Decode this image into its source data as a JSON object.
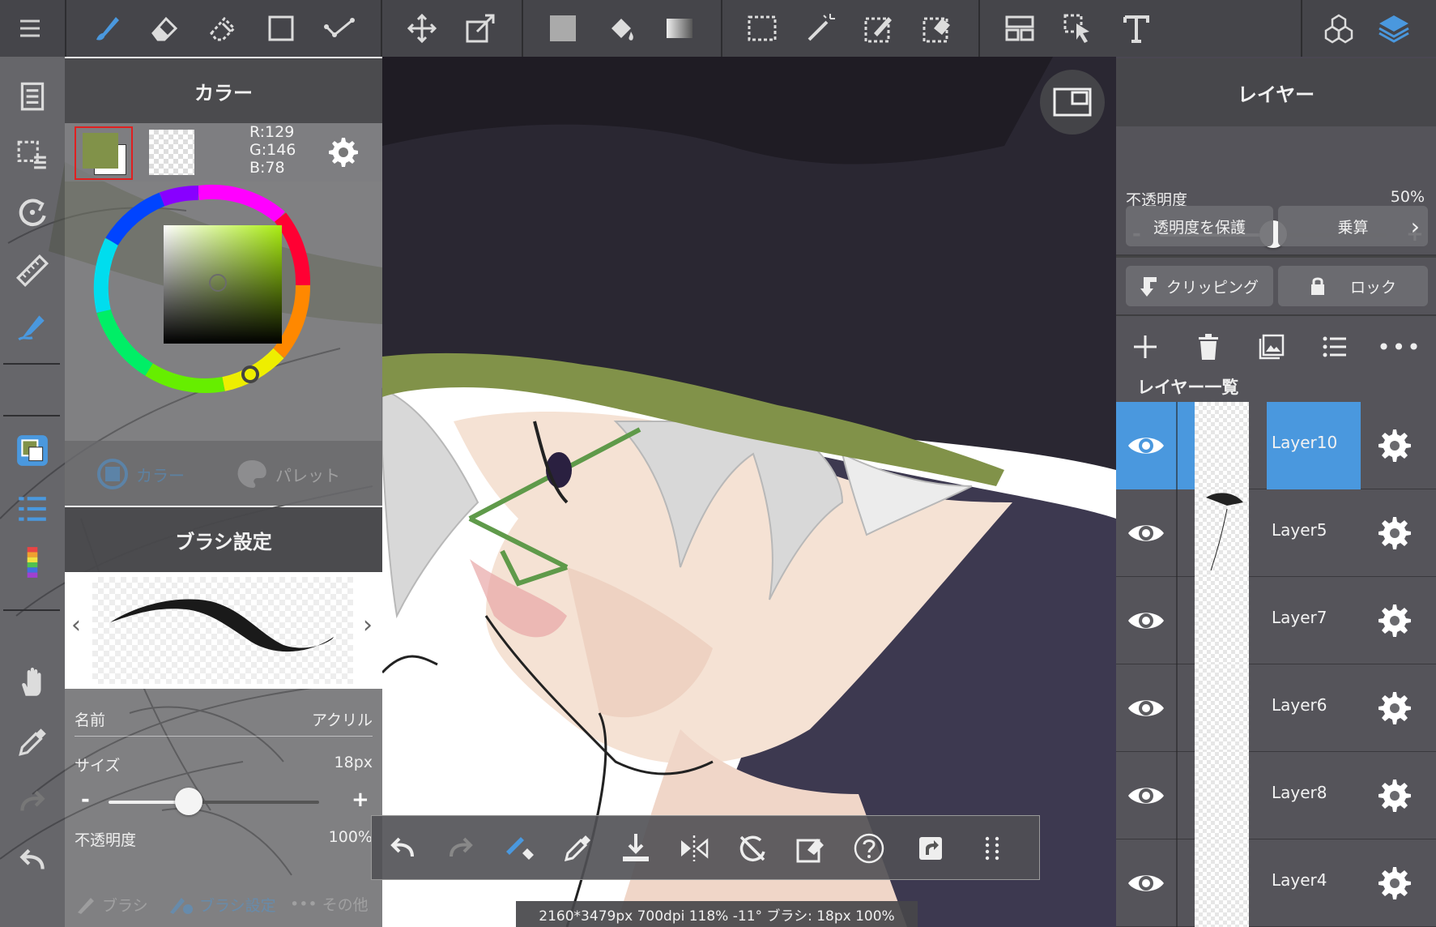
{
  "colors": {
    "primary": "#819249",
    "accent": "#4a98de",
    "panel": "#5f5f62",
    "selection": "#e02020"
  },
  "toolbar": {
    "tools": [
      {
        "name": "menu-icon"
      },
      {
        "name": "brush-icon",
        "active": true
      },
      {
        "name": "eraser-icon"
      },
      {
        "name": "blur-icon"
      },
      {
        "name": "shape-icon"
      },
      {
        "name": "dot-icon"
      },
      {
        "name": "move-icon"
      },
      {
        "name": "transform-icon"
      },
      {
        "name": "fill-color-icon"
      },
      {
        "name": "bucket-icon"
      },
      {
        "name": "gradient-icon"
      },
      {
        "name": "select-rect-icon"
      },
      {
        "name": "magic-wand-icon"
      },
      {
        "name": "select-pen-icon"
      },
      {
        "name": "select-eraser-icon"
      },
      {
        "name": "frame-divider-icon"
      },
      {
        "name": "operation-icon"
      },
      {
        "name": "text-icon"
      },
      {
        "name": "materials-icon"
      },
      {
        "name": "layers-icon",
        "active": true
      }
    ]
  },
  "color_panel": {
    "title": "カラー",
    "fg_color": "#819249",
    "bg_color": "#ffffff",
    "r": "R:129",
    "g": "G:146",
    "b": "B:78",
    "tabs": [
      "カラー",
      "パレット"
    ]
  },
  "brush_panel": {
    "title": "ブラシ設定",
    "name_label": "名前",
    "name_value": "アクリル",
    "size_label": "サイズ",
    "size_value": "18px",
    "size_fraction": 0.38,
    "opacity_label": "不透明度",
    "opacity_value": "100%",
    "minus": "-",
    "plus": "+",
    "tabs": [
      "ブラシ",
      "ブラシ設定",
      "その他"
    ]
  },
  "layer_panel": {
    "title": "レイヤー",
    "opacity_label": "不透明度",
    "opacity_value": "50%",
    "opacity_fraction": 0.5,
    "minus": "-",
    "plus": "+",
    "protect_alpha": "透明度を保護",
    "blend_mode": "乗算",
    "clipping": "クリッピング",
    "lock": "ロック",
    "list_title": "レイヤー一覧",
    "layers": [
      {
        "name": "Layer10",
        "active": true
      },
      {
        "name": "Layer5",
        "active": false
      },
      {
        "name": "Layer7",
        "active": false
      },
      {
        "name": "Layer6",
        "active": false
      },
      {
        "name": "Layer8",
        "active": false
      },
      {
        "name": "Layer4",
        "active": false
      }
    ]
  },
  "status_bar": {
    "text": "2160*3479px 700dpi 118% -11° ブラシ: 18px 100%"
  }
}
